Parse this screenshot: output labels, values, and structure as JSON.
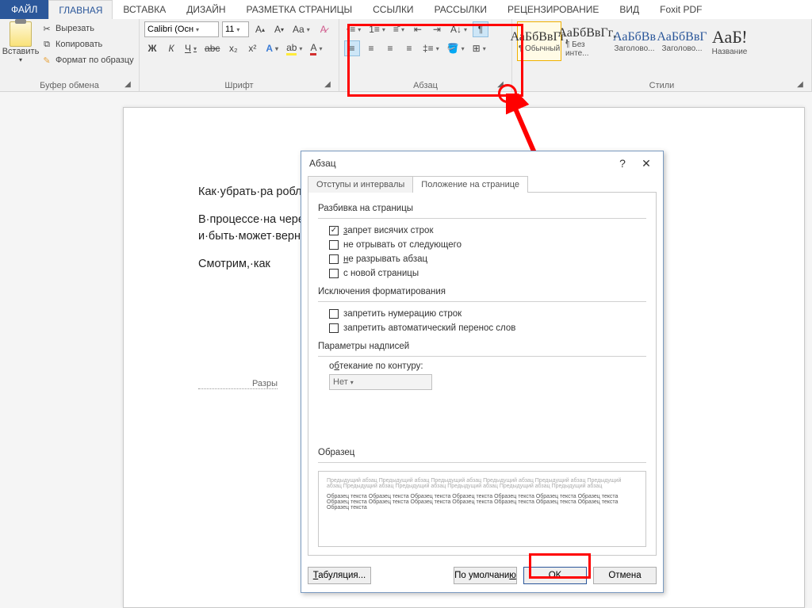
{
  "tabs": {
    "file": "ФАЙЛ",
    "home": "ГЛАВНАЯ",
    "insert": "ВСТАВКА",
    "design": "ДИЗАЙН",
    "layout": "РАЗМЕТКА СТРАНИЦЫ",
    "refs": "ССЫЛКИ",
    "mail": "РАССЫЛКИ",
    "review": "РЕЦЕНЗИРОВАНИЕ",
    "view": "ВИД",
    "foxit": "Foxit PDF"
  },
  "clipboard": {
    "paste": "Вставить",
    "cut": "Вырезать",
    "copy": "Копировать",
    "fmt": "Формат по образцу",
    "label": "Буфер обмена"
  },
  "font": {
    "name": "Calibri (Осн",
    "size": "11",
    "label": "Шрифт",
    "bold": "Ж",
    "italic": "К",
    "under": "Ч",
    "strike": "abc",
    "sub": "x₂",
    "sup": "x²"
  },
  "para": {
    "label": "Абзац"
  },
  "styles": {
    "label": "Стили",
    "items": [
      {
        "prev": "АаБбВвГг,",
        "name": "¶ Обычный"
      },
      {
        "prev": "АаБбВвГг,",
        "name": "¶ Без инте..."
      },
      {
        "prev": "АаБбВв",
        "name": "Заголово..."
      },
      {
        "prev": "АаБбВвГ",
        "name": "Заголово..."
      },
      {
        "prev": "АаБ!",
        "name": "Название"
      }
    ]
  },
  "doc": {
    "p1": "Как·убрать·ра                                                                                                        роблем·как·небывало¶",
    "p2": "В·процессе·на                                                                                                        чередного·символа,·программа·W                                                                                                        редактора.·В·том·случае·если·ва                                                                                                        и·быть·может·вернуть·на·пр                                                                                                        к·произвести·обратное·дей                                                                                                        ер.·¶",
    "p3": "Смотрим,·как",
    "break": "Разры"
  },
  "dialog": {
    "title": "Абзац",
    "help": "?",
    "close": "✕",
    "tab1": "Отступы и интервалы",
    "tab2": "Положение на странице",
    "sec1": "Разбивка на страницы",
    "c1": "запрет висячих строк",
    "c2": "не отрывать от следующего",
    "c3": "не разрывать абзац",
    "c4": "с новой страницы",
    "sec2": "Исключения форматирования",
    "c5": "запретить нумерацию строк",
    "c6": "запретить автоматический перенос слов",
    "sec3": "Параметры надписей",
    "wrap": "обтекание по контуру:",
    "none": "Нет",
    "sec4": "Образец",
    "prevtext": "Предыдущий абзац Предыдущий абзац Предыдущий абзац Предыдущий абзац Предыдущий абзац Предыдущий абзац Предыдущий абзац Предыдущий абзац Предыдущий абзац Предыдущий абзац Предыдущий абзац",
    "sampletext": "Образец текста Образец текста Образец текста Образец текста Образец текста Образец текста Образец текста Образец текста Образец текста Образец текста Образец текста Образец текста Образец текста Образец текста Образец текста",
    "tabs_btn": "Табуляция...",
    "default_btn": "По умолчанию",
    "ok": "OK",
    "cancel": "Отмена"
  }
}
